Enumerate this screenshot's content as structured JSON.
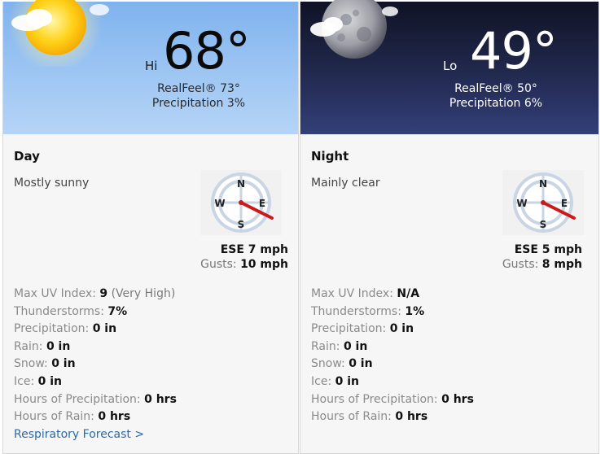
{
  "day": {
    "hi_label": "Hi",
    "temp": "68°",
    "realfeel": "RealFeel® 73°",
    "precip": "Precipitation 3%",
    "title": "Day",
    "condition": "Mostly sunny",
    "wind": "ESE 7 mph",
    "gusts_label": "Gusts:",
    "gusts_value": "10 mph",
    "compass_n": "N",
    "compass_e": "E",
    "compass_s": "S",
    "compass_w": "W",
    "stats": [
      {
        "label": "Max UV Index:",
        "value": "9",
        "note": "(Very High)"
      },
      {
        "label": "Thunderstorms:",
        "value": "7%"
      },
      {
        "label": "Precipitation:",
        "value": "0 in"
      },
      {
        "label": "Rain:",
        "value": "0 in"
      },
      {
        "label": "Snow:",
        "value": "0 in"
      },
      {
        "label": "Ice:",
        "value": "0 in"
      },
      {
        "label": "Hours of Precipitation:",
        "value": "0 hrs"
      },
      {
        "label": "Hours of Rain:",
        "value": "0 hrs"
      }
    ],
    "link": "Respiratory Forecast >"
  },
  "night": {
    "lo_label": "Lo",
    "temp": "49°",
    "realfeel": "RealFeel® 50°",
    "precip": "Precipitation 6%",
    "title": "Night",
    "condition": "Mainly clear",
    "wind": "ESE 5 mph",
    "gusts_label": "Gusts:",
    "gusts_value": "8 mph",
    "compass_n": "N",
    "compass_e": "E",
    "compass_s": "S",
    "compass_w": "W",
    "stats": [
      {
        "label": "Max UV Index:",
        "value": "N/A"
      },
      {
        "label": "Thunderstorms:",
        "value": "1%"
      },
      {
        "label": "Precipitation:",
        "value": "0 in"
      },
      {
        "label": "Rain:",
        "value": "0 in"
      },
      {
        "label": "Snow:",
        "value": "0 in"
      },
      {
        "label": "Ice:",
        "value": "0 in"
      },
      {
        "label": "Hours of Precipitation:",
        "value": "0 hrs"
      },
      {
        "label": "Hours of Rain:",
        "value": "0 hrs"
      }
    ]
  },
  "colors": {
    "day_sky": "#9ec6f3",
    "night_sky": "#1e2547",
    "link": "#2a6aa8",
    "needle": "#cc1a1a"
  },
  "icons": {
    "day": "sun-icon",
    "night": "moon-icon",
    "wind": "compass-icon"
  }
}
